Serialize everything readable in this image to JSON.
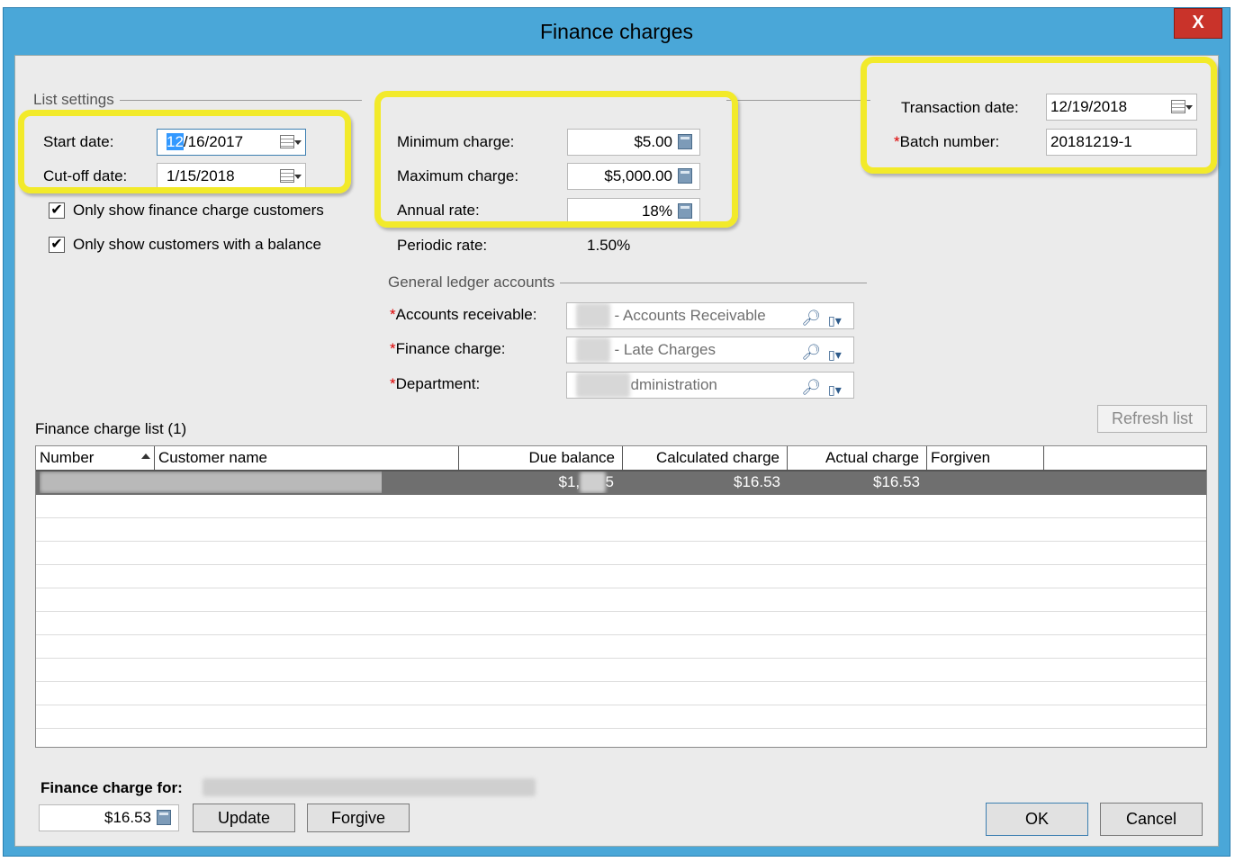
{
  "window": {
    "title": "Finance charges",
    "close_label": "X"
  },
  "list_settings": {
    "group_label": "List settings",
    "start_date_label": "Start date:",
    "start_date_sel": "12",
    "start_date_rest": "/16/2017",
    "cutoff_date_label": "Cut-off date:",
    "cutoff_date": "1/15/2018",
    "only_finance_label": "Only show finance charge customers",
    "only_finance_checked": "✔",
    "only_balance_label": "Only show customers with a balance",
    "only_balance_checked": "✔"
  },
  "finance_charge_settings": {
    "minimum_label": "Minimum charge:",
    "minimum_value": "$5.00",
    "maximum_label": "Maximum charge:",
    "maximum_value": "$5,000.00",
    "annual_label": "Annual rate:",
    "annual_value": "18%",
    "periodic_label": "Periodic rate:",
    "periodic_value": "1.50%"
  },
  "gl_accounts": {
    "group_label": "General ledger accounts",
    "required_mark": "*",
    "ar_label": "Accounts receivable:",
    "ar_value": " - Accounts Receivable",
    "fc_label": "Finance charge:",
    "fc_value": " - Late Charges",
    "dept_label": "Department:",
    "dept_value": "dministration"
  },
  "transaction": {
    "date_label": "Transaction date:",
    "date_value": "12/19/2018",
    "batch_label": "Batch number:",
    "batch_value": "20181219-1"
  },
  "list": {
    "title": "Finance charge list (1)",
    "refresh_label": "Refresh list",
    "columns": [
      "Number",
      "Customer name",
      "Due balance",
      "Calculated charge",
      "Actual charge",
      "Forgiven"
    ],
    "row": {
      "due_balance": "$1,",
      "due_balance_tail": "5",
      "calculated_charge": "$16.53",
      "actual_charge": "$16.53"
    }
  },
  "footer": {
    "charge_for_label": "Finance charge for:",
    "charge_value": "$16.53",
    "update_label": "Update",
    "forgive_label": "Forgive",
    "ok_label": "OK",
    "cancel_label": "Cancel"
  }
}
